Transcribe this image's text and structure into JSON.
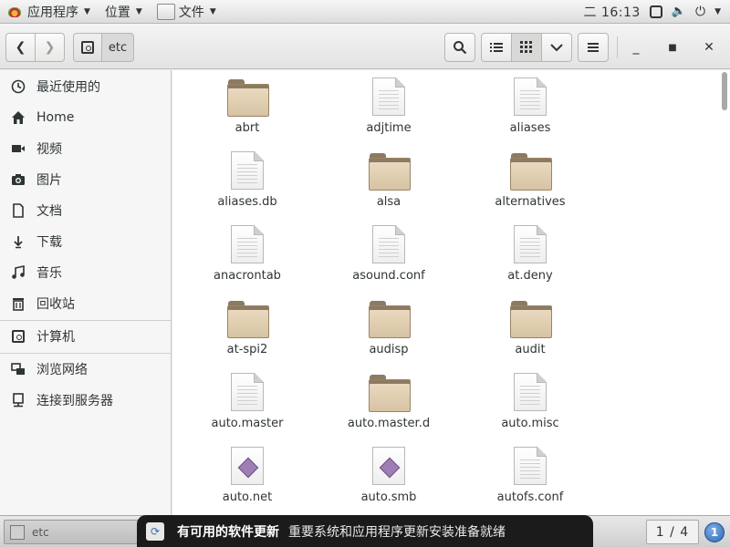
{
  "top_panel": {
    "apps_menu": "应用程序",
    "places_menu": "位置",
    "files_menu": "文件",
    "clock": "二 16:13"
  },
  "header": {
    "location_segment": "etc"
  },
  "sidebar": {
    "items": [
      {
        "label": "最近使用的",
        "icon": "clock-icon"
      },
      {
        "label": "Home",
        "icon": "home-icon"
      },
      {
        "label": "视频",
        "icon": "video-icon"
      },
      {
        "label": "图片",
        "icon": "camera-icon"
      },
      {
        "label": "文档",
        "icon": "document-icon"
      },
      {
        "label": "下载",
        "icon": "download-icon"
      },
      {
        "label": "音乐",
        "icon": "music-icon"
      },
      {
        "label": "回收站",
        "icon": "trash-icon"
      },
      {
        "label": "计算机",
        "icon": "drive-icon"
      },
      {
        "label": "浏览网络",
        "icon": "network-icon"
      },
      {
        "label": "连接到服务器",
        "icon": "server-icon"
      }
    ]
  },
  "files": [
    {
      "name": "abrt",
      "type": "folder"
    },
    {
      "name": "adjtime",
      "type": "text"
    },
    {
      "name": "aliases",
      "type": "text"
    },
    {
      "name": "aliases.db",
      "type": "text"
    },
    {
      "name": "alsa",
      "type": "folder"
    },
    {
      "name": "alternatives",
      "type": "folder"
    },
    {
      "name": "anacrontab",
      "type": "text"
    },
    {
      "name": "asound.conf",
      "type": "text"
    },
    {
      "name": "at.deny",
      "type": "text"
    },
    {
      "name": "at-spi2",
      "type": "folder"
    },
    {
      "name": "audisp",
      "type": "folder"
    },
    {
      "name": "audit",
      "type": "folder"
    },
    {
      "name": "auto.master",
      "type": "text"
    },
    {
      "name": "auto.master.d",
      "type": "folder"
    },
    {
      "name": "auto.misc",
      "type": "text"
    },
    {
      "name": "auto.net",
      "type": "script"
    },
    {
      "name": "auto.smb",
      "type": "script"
    },
    {
      "name": "autofs.conf",
      "type": "text"
    }
  ],
  "taskbar": {
    "window_label": "etc",
    "workspace": "1 / 4",
    "notification_count": "1"
  },
  "notification": {
    "title": "有可用的软件更新",
    "body": "重要系统和应用程序更新安装准备就绪"
  }
}
